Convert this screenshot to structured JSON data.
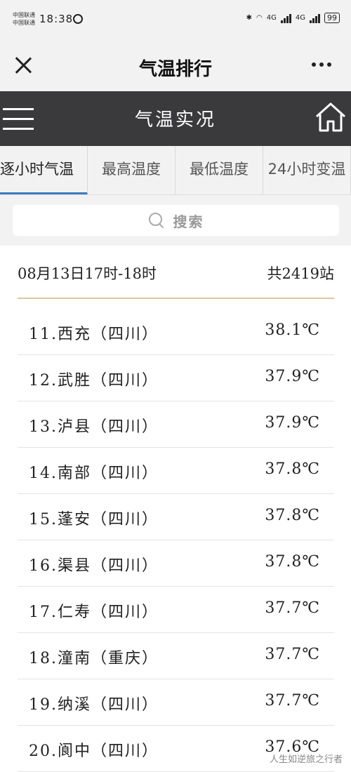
{
  "status_bar": {
    "carrier_1": "中国联通",
    "carrier_2": "中国联通",
    "time": "18:38",
    "network_1": "4G",
    "network_2": "4G",
    "battery": "99"
  },
  "titlebar": {
    "title": "气温排行"
  },
  "header": {
    "title": "气温实况"
  },
  "tabs": [
    {
      "label": "逐小时气温",
      "active": true
    },
    {
      "label": "最高温度",
      "active": false
    },
    {
      "label": "最低温度",
      "active": false
    },
    {
      "label": "24小时变温",
      "active": false
    }
  ],
  "search": {
    "label": "搜索"
  },
  "list": {
    "time_range": "08月13日17时-18时",
    "total": "共2419站",
    "rows": [
      {
        "name": "11.西充（四川）",
        "temp": "38.1℃"
      },
      {
        "name": "12.武胜（四川）",
        "temp": "37.9℃"
      },
      {
        "name": "13.泸县（四川）",
        "temp": "37.9℃"
      },
      {
        "name": "14.南部（四川）",
        "temp": "37.8℃"
      },
      {
        "name": "15.蓬安（四川）",
        "temp": "37.8℃"
      },
      {
        "name": "16.渠县（四川）",
        "temp": "37.8℃"
      },
      {
        "name": "17.仁寿（四川）",
        "temp": "37.7℃"
      },
      {
        "name": "18.潼南（重庆）",
        "temp": "37.7℃"
      },
      {
        "name": "19.纳溪（四川）",
        "temp": "37.7℃"
      },
      {
        "name": "20.阆中（四川）",
        "temp": "37.6℃"
      }
    ]
  },
  "watermark": "人生如逆旅之行者",
  "colors": {
    "header_bg": "#3a3a3c",
    "tab_active_indicator": "#3b7bc3",
    "list_divider": "#dcc99a"
  }
}
